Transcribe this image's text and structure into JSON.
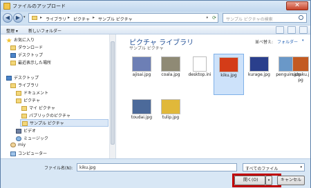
{
  "window": {
    "title": "ファイルのアップロード",
    "close_glyph": "✕"
  },
  "address": {
    "crumbs": [
      "ライブラリ",
      "ピクチャ",
      "サンプル ピクチャ"
    ],
    "separator": "▸",
    "search_placeholder": "サンプル ピクチャの検索"
  },
  "toolbar": {
    "organize": "整理 ▾",
    "new_folder": "新しいフォルダー"
  },
  "nav": {
    "items": [
      {
        "label": "お気に入り",
        "icon": "star-icon"
      },
      {
        "label": "ダウンロード",
        "icon": "folder-icon"
      },
      {
        "label": "デスクトップ",
        "icon": "desktop-icon"
      },
      {
        "label": "最近表示した場所",
        "icon": "recent-icon"
      },
      {
        "label": "デスクトップ",
        "icon": "desktop-icon"
      },
      {
        "label": "ライブラリ",
        "icon": "library-icon"
      },
      {
        "label": "ドキュメント",
        "icon": "documents-icon"
      },
      {
        "label": "ピクチャ",
        "icon": "pictures-icon"
      },
      {
        "label": "マイ ピクチャ",
        "icon": "folder-icon"
      },
      {
        "label": "パブリックのピクチャ",
        "icon": "folder-icon"
      },
      {
        "label": "サンプル ピクチャ",
        "icon": "folder-icon"
      },
      {
        "label": "ビデオ",
        "icon": "video-icon"
      },
      {
        "label": "ミュージック",
        "icon": "music-icon"
      },
      {
        "label": "miy",
        "icon": "user-icon"
      },
      {
        "label": "コンピューター",
        "icon": "computer-icon"
      }
    ]
  },
  "library": {
    "title": "ピクチャ ライブラリ",
    "subtitle": "サンプル ピクチャ",
    "arrange_label": "並べ替え:",
    "arrange_value": "フォルダー"
  },
  "files": [
    {
      "name": "ajisai.jpg",
      "color": "#6d7fb5"
    },
    {
      "name": "coala.jpg",
      "color": "#8f8a75"
    },
    {
      "name": "desktop.ini",
      "color": "#ffffff"
    },
    {
      "name": "kiku.jpg",
      "color": "#d43c18"
    },
    {
      "name": "kurage.jpg",
      "color": "#2a3f8c"
    },
    {
      "name": "penguin.jpg",
      "color": "#6a98c8"
    },
    {
      "name": "sabaku.jpg",
      "color": "#c35a22"
    },
    {
      "name": "toudai.jpg",
      "color": "#4c6a9a"
    },
    {
      "name": "tulip.jpg",
      "color": "#e0b83a"
    }
  ],
  "footer": {
    "filename_label": "ファイル名(N):",
    "filename_value": "kiku.jpg",
    "filetype_value": "すべてのファイル",
    "open_label": "開く(O)",
    "cancel_label": "キャンセル"
  }
}
